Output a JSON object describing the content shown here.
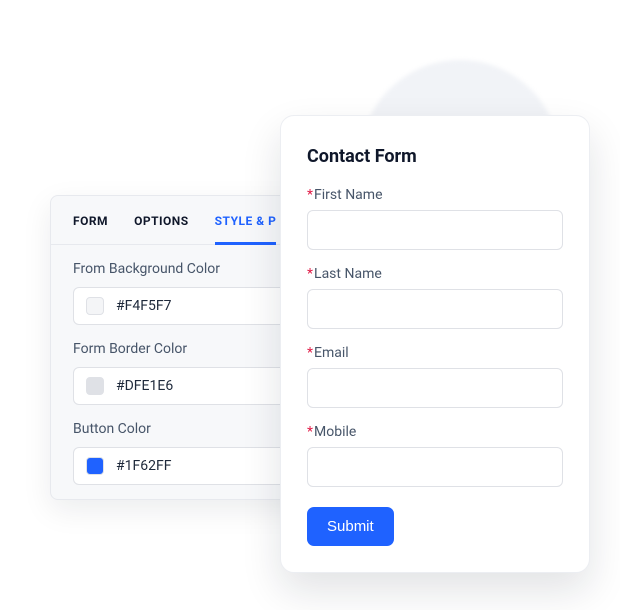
{
  "panel": {
    "tabs": [
      {
        "label": "FORM",
        "active": false
      },
      {
        "label": "OPTIONS",
        "active": false
      },
      {
        "label": "STYLE & P",
        "active": true
      }
    ],
    "fields": {
      "bg_color": {
        "label": "From Background Color",
        "value": "#F4F5F7",
        "swatch": "#F4F5F7"
      },
      "border": {
        "label": "Form Border Color",
        "value": "#DFE1E6",
        "swatch": "#DFE1E6"
      },
      "button": {
        "label": "Button Color",
        "value": "#1F62FF",
        "swatch": "#1F62FF"
      }
    }
  },
  "contact_form": {
    "title": "Contact Form",
    "required_mark": "*",
    "fields": {
      "first_name": {
        "label": "First Name",
        "required": true,
        "value": ""
      },
      "last_name": {
        "label": "Last Name",
        "required": true,
        "value": ""
      },
      "email": {
        "label": "Email",
        "required": true,
        "value": ""
      },
      "mobile": {
        "label": "Mobile",
        "required": true,
        "value": ""
      }
    },
    "submit_label": "Submit"
  },
  "colors": {
    "accent": "#1F62FF"
  }
}
